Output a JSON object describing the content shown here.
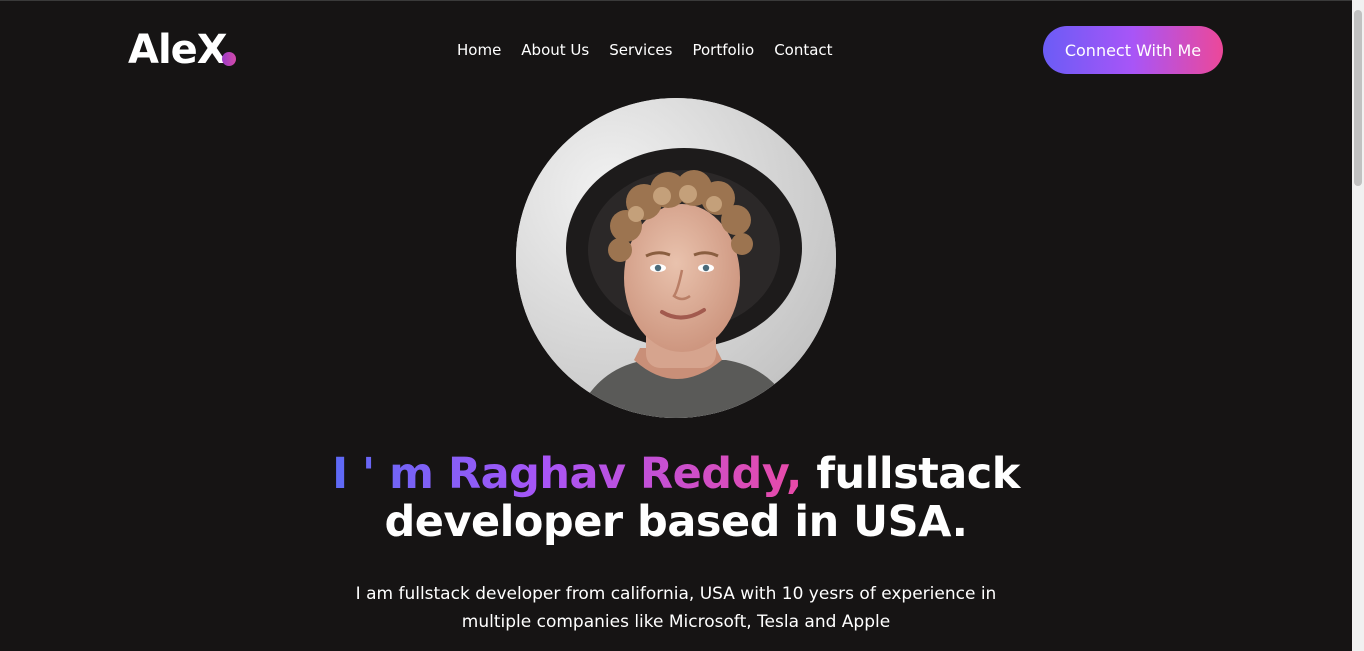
{
  "brand": {
    "logo_text": "AleX"
  },
  "nav": {
    "items": [
      {
        "label": "Home"
      },
      {
        "label": "About Us"
      },
      {
        "label": "Services"
      },
      {
        "label": "Portfolio"
      },
      {
        "label": "Contact"
      }
    ],
    "cta_label": "Connect With Me"
  },
  "hero": {
    "avatar_alt": "profile photo",
    "headline_gradient": "I ' m Raghav Reddy,",
    "headline_rest_line1": "fullstack",
    "headline_line2": "developer based in USA.",
    "description_line1": "I am fullstack developer from california, USA with 10 yesrs of experience in",
    "description_line2": "multiple companies like Microsoft, Tesla and Apple"
  },
  "colors": {
    "background": "#161414",
    "gradient_start": "#5d6af6",
    "gradient_mid": "#a855f7",
    "gradient_end": "#e94aa7",
    "text": "#ffffff"
  }
}
